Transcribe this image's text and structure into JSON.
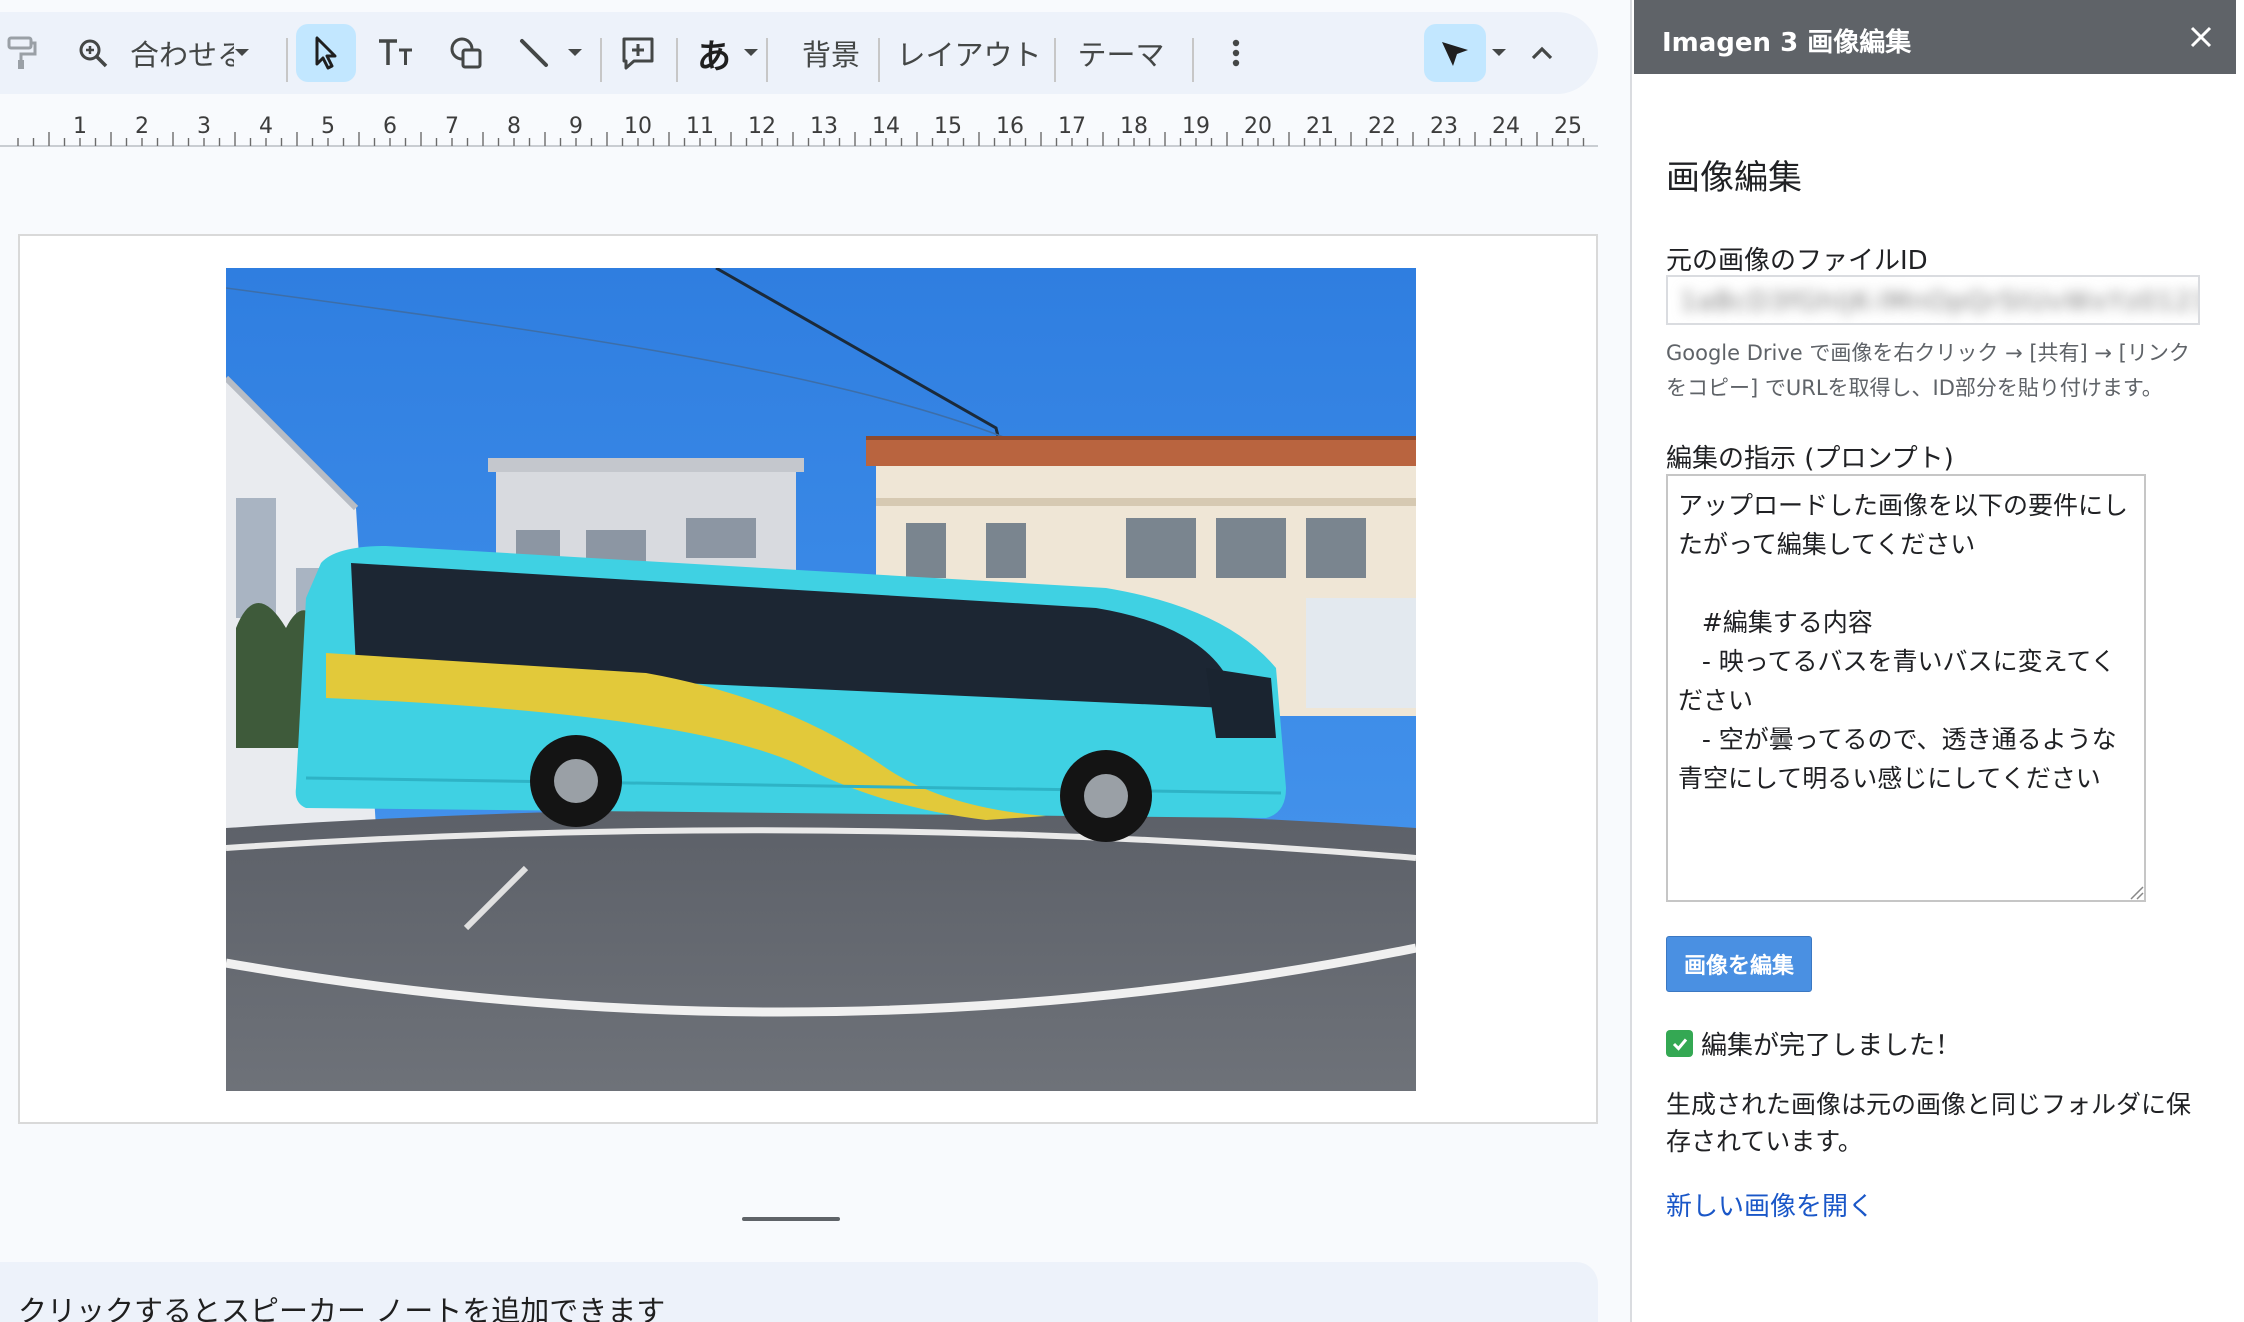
{
  "toolbar": {
    "zoom_label": "合わせる",
    "background_label": "背景",
    "layout_label": "レイアウト",
    "theme_label": "テーマ",
    "font_glyph": "あ"
  },
  "ruler": {
    "numbers": [
      "1",
      "2",
      "3",
      "4",
      "5",
      "6",
      "7",
      "8",
      "9",
      "10",
      "11",
      "12",
      "13",
      "14",
      "15",
      "16",
      "17",
      "18",
      "19",
      "20",
      "21",
      "22",
      "23",
      "24",
      "25"
    ]
  },
  "notes": {
    "placeholder": "クリックするとスピーカー ノートを追加できます"
  },
  "sidebar": {
    "title": "Imagen 3 画像編集",
    "heading": "画像編集",
    "file_id_label": "元の画像のファイルID",
    "file_id_value": "1aBcD3fGhIjK-lMnOpQrStUvWxYz0123",
    "help_text": "Google Drive で画像を右クリック → [共有] → [リンクをコピー] でURLを取得し、ID部分を貼り付けます。",
    "prompt_label": "編集の指示 (プロンプト)",
    "prompt_value": "アップロードした画像を以下の要件にしたがって編集してください\n\n   #編集する内容\n   - 映ってるバスを青いバスに変えてください\n   - 空が曇ってるので、透き通るような青空にして明るい感じにしてください",
    "edit_button": "画像を編集",
    "status_text": "編集が完了しました！",
    "result_desc": "生成された画像は元の画像と同じフォルダに保存されています。",
    "open_link": "新しい画像を開く"
  },
  "colors": {
    "sidebar_header": "#5f6368",
    "button": "#4a90e2",
    "link": "#1a57c8",
    "toolbar_bg": "#edf2fa",
    "active_tool": "#c2e7ff"
  },
  "icons": [
    "paint-format-icon",
    "zoom-icon",
    "select-cursor-icon",
    "text-box-icon",
    "shape-icon",
    "line-icon",
    "new-slide-icon",
    "font-icon",
    "more-vert-icon",
    "pointer-mode-icon",
    "collapse-icon",
    "close-icon",
    "check-icon"
  ]
}
